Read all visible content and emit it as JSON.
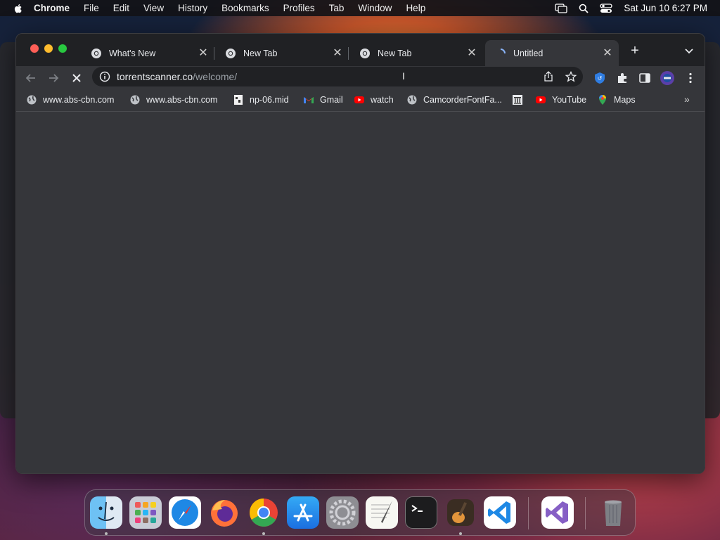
{
  "menubar": {
    "app_name": "Chrome",
    "items": [
      "File",
      "Edit",
      "View",
      "History",
      "Bookmarks",
      "Profiles",
      "Tab",
      "Window",
      "Help"
    ],
    "datetime": "Sat Jun 10  6:27 PM"
  },
  "tabs": [
    {
      "title": "What's New",
      "icon": "chrome-icon",
      "active": false
    },
    {
      "title": "New Tab",
      "icon": "chrome-icon",
      "active": false
    },
    {
      "title": "New Tab",
      "icon": "chrome-icon",
      "active": false
    },
    {
      "title": "Untitled",
      "icon": "loading-icon",
      "active": true
    }
  ],
  "toolbar": {
    "url_host": "torrentscanner.co",
    "url_path": "/welcome/",
    "loading": true
  },
  "bookmarks": [
    {
      "label": "www.abs-cbn.com",
      "icon": "globe-icon"
    },
    {
      "label": "www.abs-cbn.com",
      "icon": "globe-icon"
    },
    {
      "label": "np-06.mid",
      "icon": "file-icon"
    },
    {
      "label": "Gmail",
      "icon": "gmail-icon"
    },
    {
      "label": "watch",
      "icon": "youtube-icon"
    },
    {
      "label": "CamcorderFontFa...",
      "icon": "globe-icon"
    },
    {
      "label": "",
      "icon": "museum-icon"
    },
    {
      "label": "YouTube",
      "icon": "youtube-icon"
    },
    {
      "label": "Maps",
      "icon": "maps-icon"
    }
  ],
  "dock": [
    "Finder",
    "Launchpad",
    "Safari",
    "Firefox",
    "Chrome",
    "App Store",
    "System Preferences",
    "TextEdit",
    "Terminal",
    "GarageBand",
    "Visual Studio Code",
    "Visual Studio",
    "Trash"
  ],
  "colors": {
    "window_bg": "#202124",
    "toolbar_bg": "#35363a",
    "omnibox_bg": "#202124",
    "text": "#e8eaed",
    "muted": "#9aa0a6"
  }
}
